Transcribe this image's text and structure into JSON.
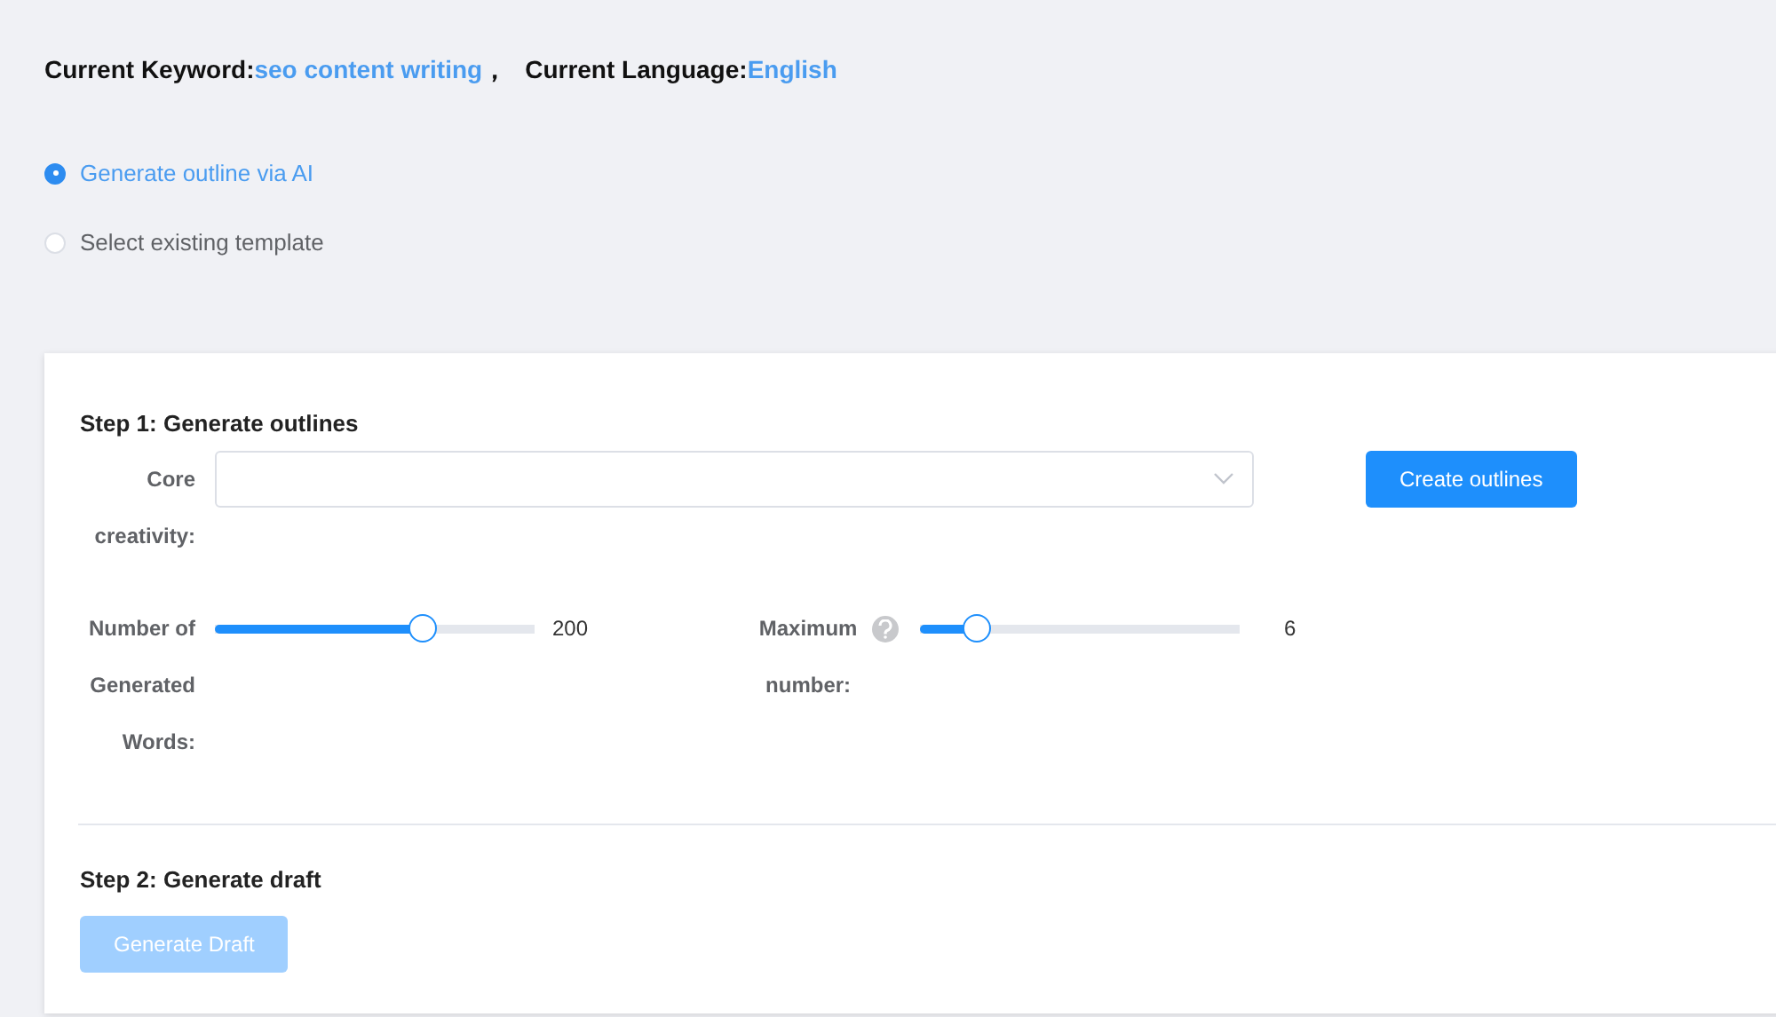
{
  "header": {
    "keyword_label": "Current Keyword:",
    "keyword": "seo content writing",
    "separator": "，",
    "language_label": "Current Language:",
    "language": "English"
  },
  "outline_source": [
    {
      "label": "Generate outline via AI",
      "selected": true
    },
    {
      "label": "Select existing template",
      "selected": false
    }
  ],
  "step1": {
    "title": "Step 1: Generate outlines",
    "core_label": "Core creativity:",
    "create_button": "Create outlines",
    "sliders": [
      {
        "label": "Number of Generated Words:",
        "help": false,
        "level": 0.65,
        "reading": "200"
      },
      {
        "label": "Maximum number:",
        "help": true,
        "level": 0.18,
        "reading": "6"
      }
    ]
  },
  "step2": {
    "title": "Step 2: Generate draft",
    "button": {
      "label": "Generate Draft",
      "disabled": true
    }
  }
}
